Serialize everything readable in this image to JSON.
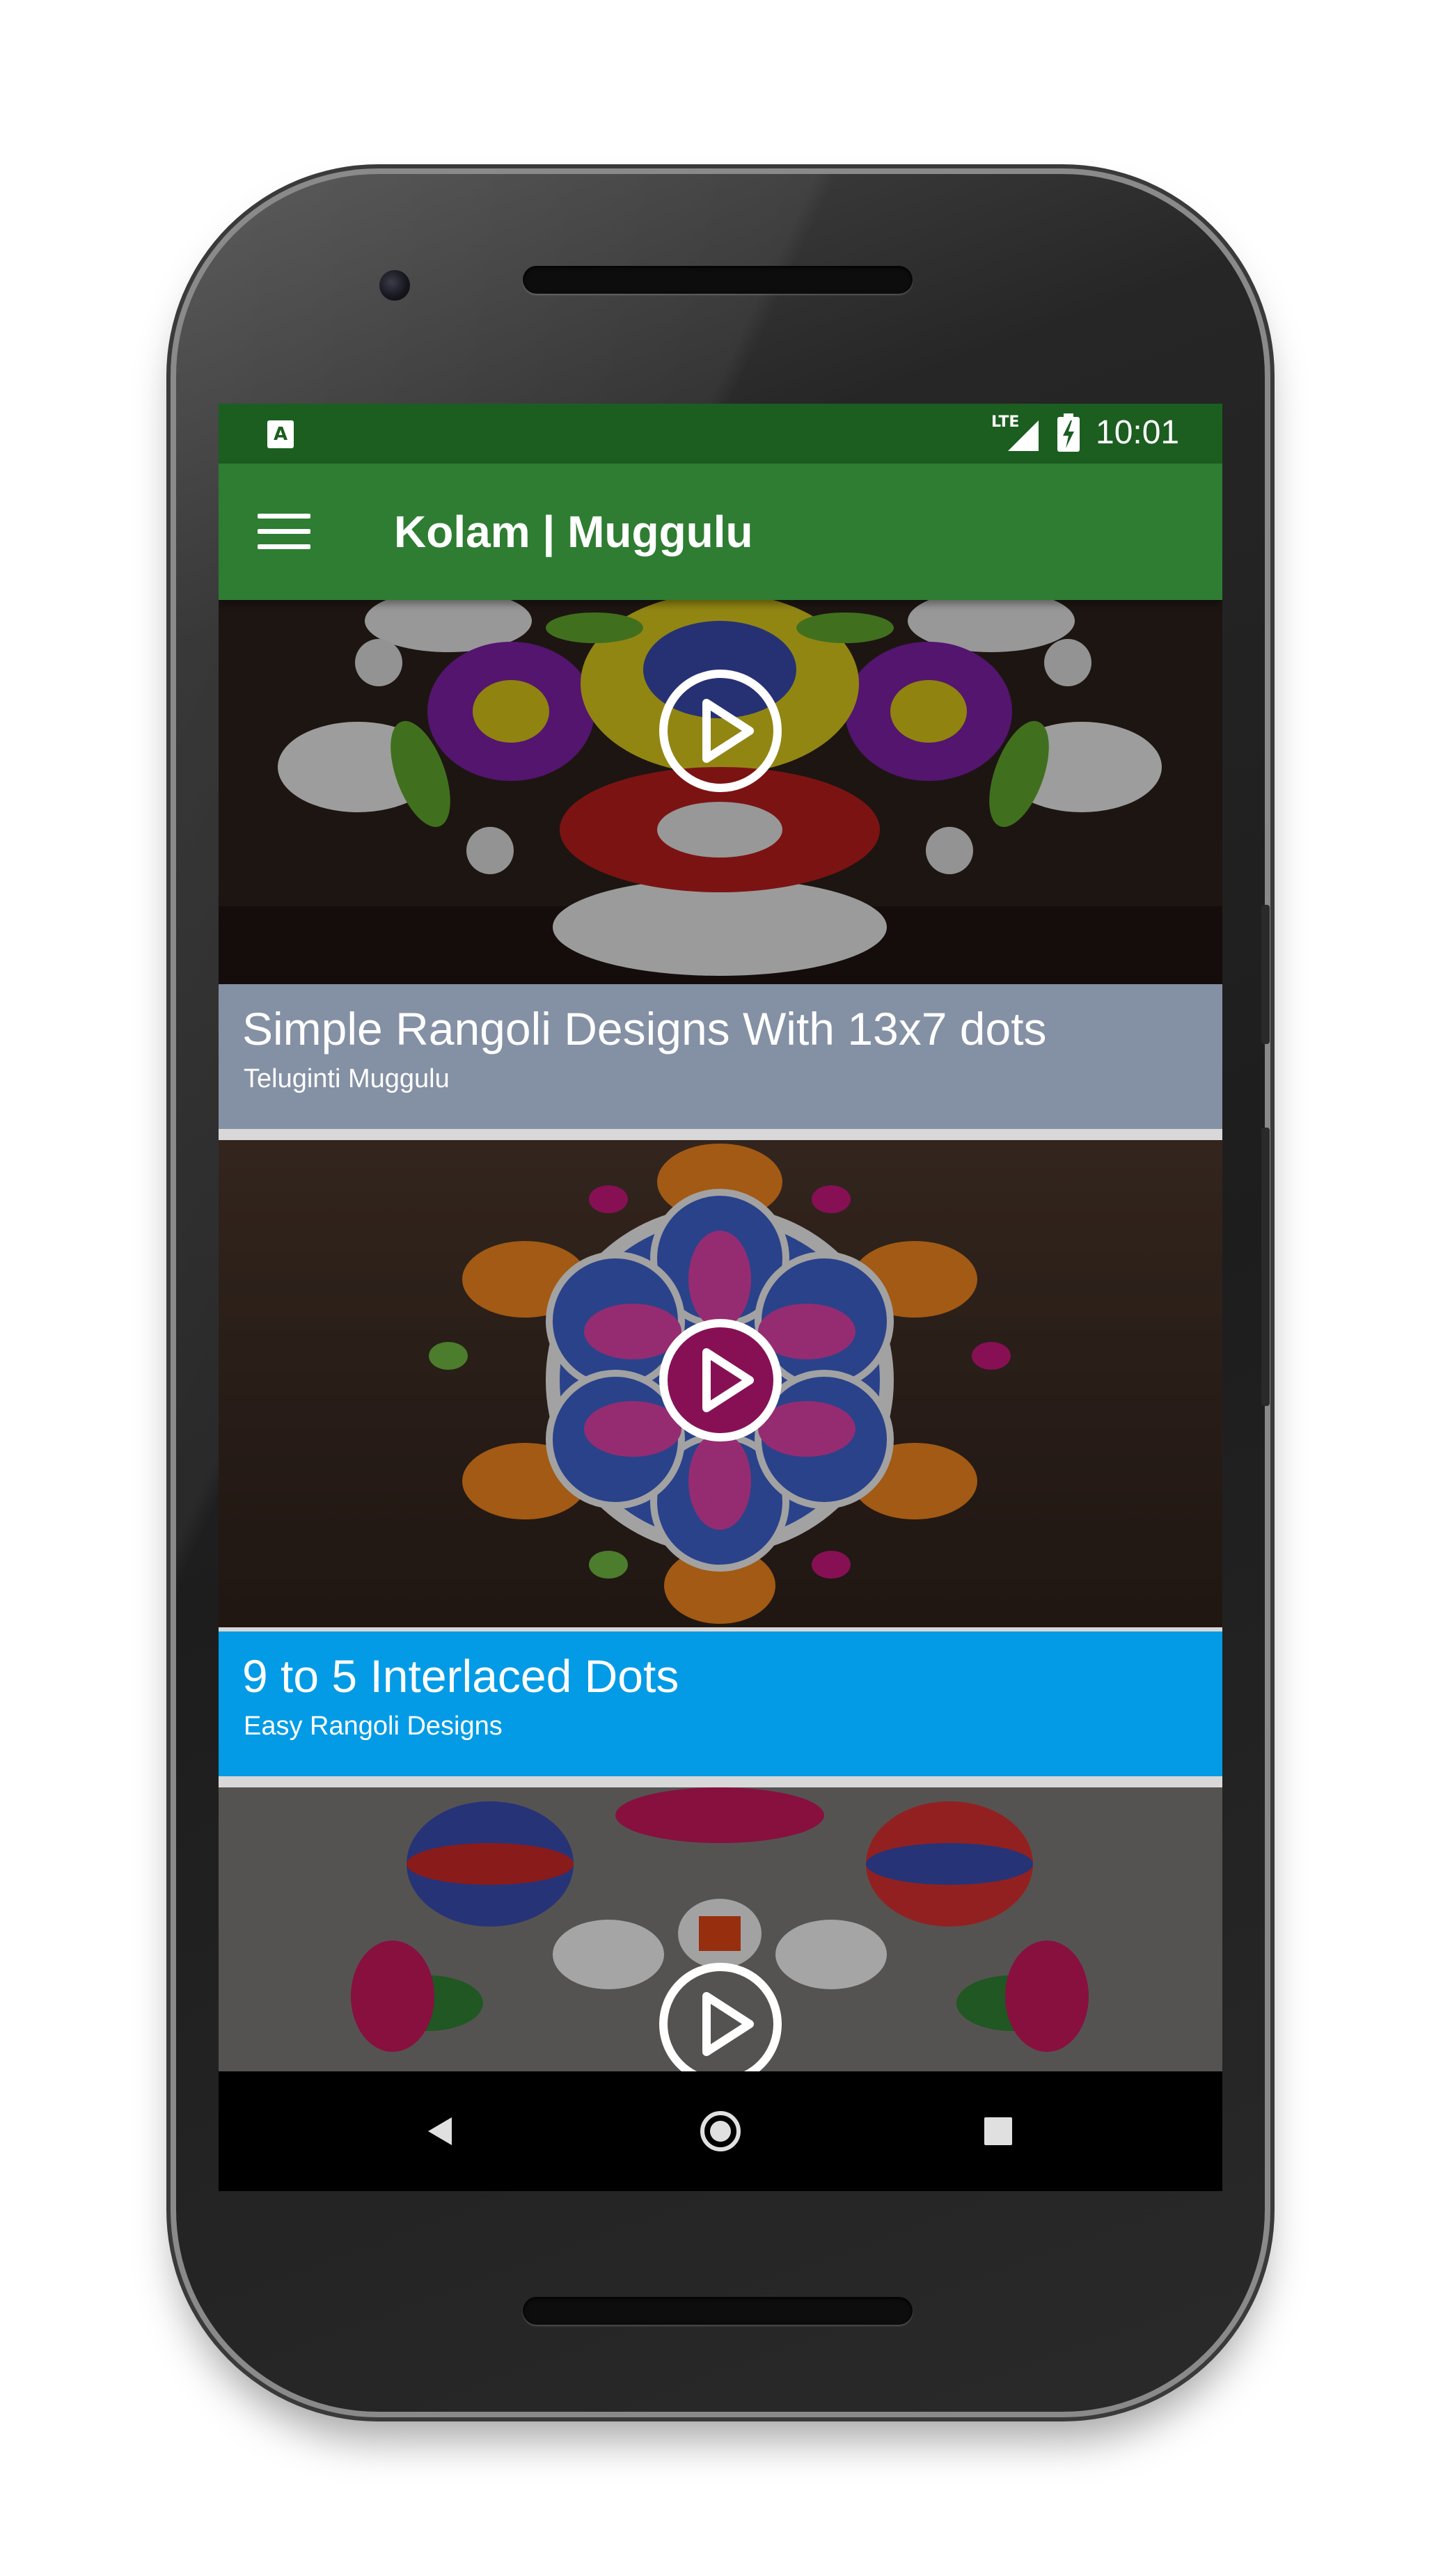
{
  "status_bar": {
    "app_badge": "A",
    "network_label": "LTE",
    "time": "10:01"
  },
  "app_bar": {
    "title": "Kolam | Muggulu"
  },
  "feed": {
    "cards": [
      {
        "title": "Simple Rangoli Designs With 13x7 dots",
        "subtitle": "Teluginti Muggulu",
        "caption_color": "#8490a4"
      },
      {
        "title": "9 to 5 Interlaced Dots",
        "subtitle": "Easy Rangoli Designs",
        "caption_color": "#039be5"
      },
      {
        "title": "",
        "subtitle": "",
        "caption_color": "#8490a4"
      }
    ]
  },
  "icons": {
    "menu": "hamburger-menu-icon",
    "play": "play-circle-icon",
    "back": "back-triangle-icon",
    "home": "home-circle-icon",
    "recents": "recents-square-icon"
  },
  "colors": {
    "status_bar": "#1b5e20",
    "app_bar": "#2e7d32",
    "nav_bar": "#000000"
  }
}
